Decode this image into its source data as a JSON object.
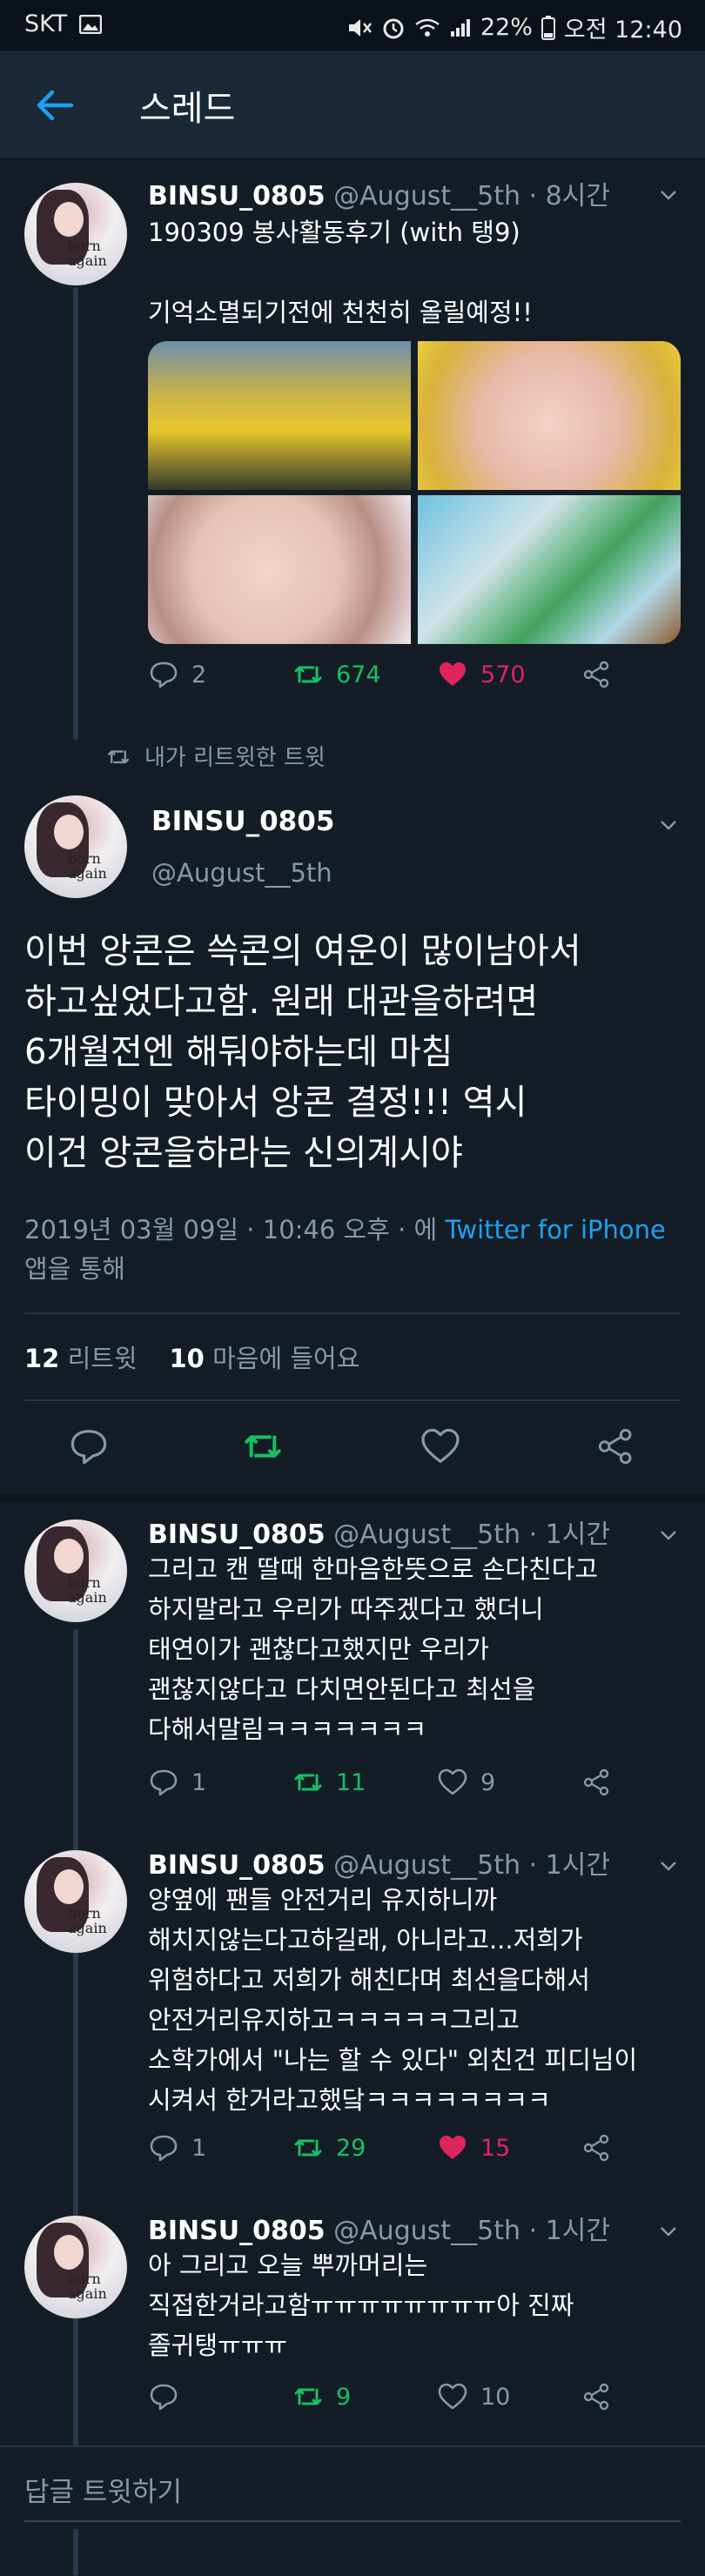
{
  "status_bar": {
    "carrier": "SKT",
    "battery": "22%",
    "time": "오전 12:40"
  },
  "app_bar": {
    "title": "스레드"
  },
  "thread": [
    {
      "name": "BINSU_0805",
      "handle": "@August__5th",
      "time": "· 8시간",
      "text": "190309 봉사활동후기 (with 탱9)\n\n기억소멸되기전에 천천히 올릴예정!!",
      "replies": "2",
      "retweets": "674",
      "likes": "570",
      "liked": true
    }
  ],
  "retweet_context": "내가 리트윗한 트윗",
  "main_tweet": {
    "name": "BINSU_0805",
    "handle": "@August__5th",
    "text": "이번 앙콘은 쓱콘의 여운이 많이남아서\n하고싶었다고함. 원래 대관을하려면\n6개월전엔 해둬야하는데 마침\n타이밍이 맞아서 앙콘 결정!!! 역시\n이건 앙콘을하라는 신의계시야",
    "date_prefix": "2019년 03월 09일 · 10:46 오후 · 에 ",
    "source": "Twitter for iPhone",
    "date_suffix": " 앱을 통해",
    "retweet_count": "12",
    "retweet_label": "리트윗",
    "like_count": "10",
    "like_label": "마음에 들어요"
  },
  "replies": [
    {
      "name": "BINSU_0805",
      "handle": "@August__5th",
      "time": "· 1시간",
      "text": "그리고 캔 딸때 한마음한뜻으로 손다친다고\n하지말라고 우리가 따주겠다고 했더니\n태연이가 괜찮다고했지만 우리가\n괜찮지않다고 다치면안된다고 최선을\n다해서말림ㅋㅋㅋㅋㅋㅋㅋ",
      "replies": "1",
      "retweets": "11",
      "likes": "9",
      "liked": false
    },
    {
      "name": "BINSU_0805",
      "handle": "@August__5th",
      "time": "· 1시간",
      "text": "양옆에 팬들 안전거리 유지하니까\n해치지않는다고하길래, 아니라고...저희가\n위험하다고 저희가 해친다며 최선을다해서\n안전거리유지하고ㅋㅋㅋㅋㅋ그리고\n소학가에서 \"나는 할 수 있다\" 외친건 피디님이\n시켜서 한거라고했닼ㅋㅋㅋㅋㅋㅋㅋㅋ",
      "replies": "1",
      "retweets": "29",
      "likes": "15",
      "liked": true
    },
    {
      "name": "BINSU_0805",
      "handle": "@August__5th",
      "time": "· 1시간",
      "text": "아 그리고 오늘 뿌까머리는\n직접한거라고함ㅠㅠㅠㅠㅠㅠㅠㅠ아 진짜\n졸귀탱ㅠㅠㅠ",
      "replies": "",
      "retweets": "9",
      "likes": "10",
      "liked": false
    }
  ],
  "reply_box": {
    "placeholder": "답글 트윗하기"
  },
  "colors": {
    "background": "#141d26",
    "link": "#1da1f2",
    "retweet": "#17bf63",
    "like": "#e0245e",
    "muted": "#8899a6"
  }
}
